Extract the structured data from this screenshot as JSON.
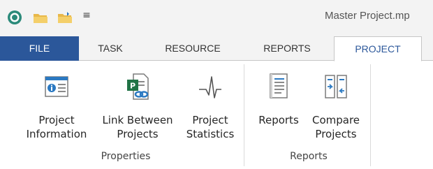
{
  "window": {
    "title": "Master Project.mp"
  },
  "quick_access": {
    "icons": [
      "app-logo-icon",
      "open-folder-icon",
      "new-folder-icon",
      "customize-dropdown-icon"
    ],
    "more_glyph": "≡"
  },
  "tabs": [
    {
      "id": "file",
      "label": "FILE"
    },
    {
      "id": "task",
      "label": "TASK"
    },
    {
      "id": "resource",
      "label": "RESOURCE"
    },
    {
      "id": "reports",
      "label": "REPORTS"
    },
    {
      "id": "project",
      "label": "PROJECT",
      "active": true
    }
  ],
  "ribbon": {
    "groups": [
      {
        "label": "Properties",
        "buttons": [
          {
            "line1": "Project",
            "line2": "Information",
            "icon": "project-information-icon"
          },
          {
            "line1": "Link Between",
            "line2": "Projects",
            "icon": "link-between-projects-icon"
          },
          {
            "line1": "Project",
            "line2": "Statistics",
            "icon": "project-statistics-icon"
          }
        ]
      },
      {
        "label": "Reports",
        "buttons": [
          {
            "line1": "Reports",
            "line2": "",
            "icon": "reports-icon"
          },
          {
            "line1": "Compare",
            "line2": "Projects",
            "icon": "compare-projects-icon"
          }
        ]
      }
    ]
  },
  "colors": {
    "file_tab": "#2b579a",
    "accent": "#2b579a",
    "ribbon_bg": "#ffffff",
    "titlebar_bg": "#f3f3f3"
  }
}
